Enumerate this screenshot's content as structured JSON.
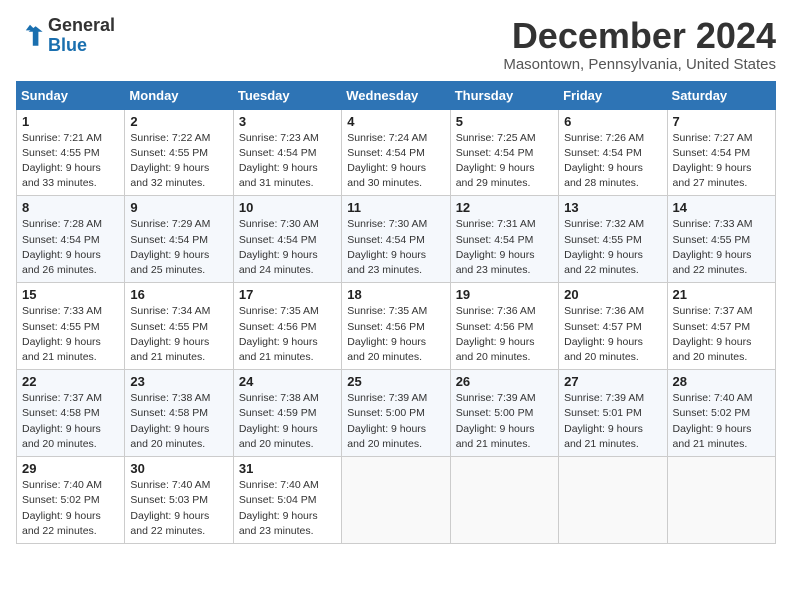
{
  "header": {
    "logo_general": "General",
    "logo_blue": "Blue",
    "main_title": "December 2024",
    "subtitle": "Masontown, Pennsylvania, United States"
  },
  "calendar": {
    "days_of_week": [
      "Sunday",
      "Monday",
      "Tuesday",
      "Wednesday",
      "Thursday",
      "Friday",
      "Saturday"
    ],
    "weeks": [
      [
        null,
        null,
        null,
        null,
        null,
        null,
        null
      ],
      null,
      null,
      null,
      null,
      null
    ],
    "cells": [
      {
        "day": "1",
        "sunrise": "7:21 AM",
        "sunset": "4:55 PM",
        "daylight": "9 hours and 33 minutes.",
        "dow": 0
      },
      {
        "day": "2",
        "sunrise": "7:22 AM",
        "sunset": "4:55 PM",
        "daylight": "9 hours and 32 minutes.",
        "dow": 1
      },
      {
        "day": "3",
        "sunrise": "7:23 AM",
        "sunset": "4:54 PM",
        "daylight": "9 hours and 31 minutes.",
        "dow": 2
      },
      {
        "day": "4",
        "sunrise": "7:24 AM",
        "sunset": "4:54 PM",
        "daylight": "9 hours and 30 minutes.",
        "dow": 3
      },
      {
        "day": "5",
        "sunrise": "7:25 AM",
        "sunset": "4:54 PM",
        "daylight": "9 hours and 29 minutes.",
        "dow": 4
      },
      {
        "day": "6",
        "sunrise": "7:26 AM",
        "sunset": "4:54 PM",
        "daylight": "9 hours and 28 minutes.",
        "dow": 5
      },
      {
        "day": "7",
        "sunrise": "7:27 AM",
        "sunset": "4:54 PM",
        "daylight": "9 hours and 27 minutes.",
        "dow": 6
      },
      {
        "day": "8",
        "sunrise": "7:28 AM",
        "sunset": "4:54 PM",
        "daylight": "9 hours and 26 minutes.",
        "dow": 0
      },
      {
        "day": "9",
        "sunrise": "7:29 AM",
        "sunset": "4:54 PM",
        "daylight": "9 hours and 25 minutes.",
        "dow": 1
      },
      {
        "day": "10",
        "sunrise": "7:30 AM",
        "sunset": "4:54 PM",
        "daylight": "9 hours and 24 minutes.",
        "dow": 2
      },
      {
        "day": "11",
        "sunrise": "7:30 AM",
        "sunset": "4:54 PM",
        "daylight": "9 hours and 23 minutes.",
        "dow": 3
      },
      {
        "day": "12",
        "sunrise": "7:31 AM",
        "sunset": "4:54 PM",
        "daylight": "9 hours and 23 minutes.",
        "dow": 4
      },
      {
        "day": "13",
        "sunrise": "7:32 AM",
        "sunset": "4:55 PM",
        "daylight": "9 hours and 22 minutes.",
        "dow": 5
      },
      {
        "day": "14",
        "sunrise": "7:33 AM",
        "sunset": "4:55 PM",
        "daylight": "9 hours and 22 minutes.",
        "dow": 6
      },
      {
        "day": "15",
        "sunrise": "7:33 AM",
        "sunset": "4:55 PM",
        "daylight": "9 hours and 21 minutes.",
        "dow": 0
      },
      {
        "day": "16",
        "sunrise": "7:34 AM",
        "sunset": "4:55 PM",
        "daylight": "9 hours and 21 minutes.",
        "dow": 1
      },
      {
        "day": "17",
        "sunrise": "7:35 AM",
        "sunset": "4:56 PM",
        "daylight": "9 hours and 21 minutes.",
        "dow": 2
      },
      {
        "day": "18",
        "sunrise": "7:35 AM",
        "sunset": "4:56 PM",
        "daylight": "9 hours and 20 minutes.",
        "dow": 3
      },
      {
        "day": "19",
        "sunrise": "7:36 AM",
        "sunset": "4:56 PM",
        "daylight": "9 hours and 20 minutes.",
        "dow": 4
      },
      {
        "day": "20",
        "sunrise": "7:36 AM",
        "sunset": "4:57 PM",
        "daylight": "9 hours and 20 minutes.",
        "dow": 5
      },
      {
        "day": "21",
        "sunrise": "7:37 AM",
        "sunset": "4:57 PM",
        "daylight": "9 hours and 20 minutes.",
        "dow": 6
      },
      {
        "day": "22",
        "sunrise": "7:37 AM",
        "sunset": "4:58 PM",
        "daylight": "9 hours and 20 minutes.",
        "dow": 0
      },
      {
        "day": "23",
        "sunrise": "7:38 AM",
        "sunset": "4:58 PM",
        "daylight": "9 hours and 20 minutes.",
        "dow": 1
      },
      {
        "day": "24",
        "sunrise": "7:38 AM",
        "sunset": "4:59 PM",
        "daylight": "9 hours and 20 minutes.",
        "dow": 2
      },
      {
        "day": "25",
        "sunrise": "7:39 AM",
        "sunset": "5:00 PM",
        "daylight": "9 hours and 20 minutes.",
        "dow": 3
      },
      {
        "day": "26",
        "sunrise": "7:39 AM",
        "sunset": "5:00 PM",
        "daylight": "9 hours and 21 minutes.",
        "dow": 4
      },
      {
        "day": "27",
        "sunrise": "7:39 AM",
        "sunset": "5:01 PM",
        "daylight": "9 hours and 21 minutes.",
        "dow": 5
      },
      {
        "day": "28",
        "sunrise": "7:40 AM",
        "sunset": "5:02 PM",
        "daylight": "9 hours and 21 minutes.",
        "dow": 6
      },
      {
        "day": "29",
        "sunrise": "7:40 AM",
        "sunset": "5:02 PM",
        "daylight": "9 hours and 22 minutes.",
        "dow": 0
      },
      {
        "day": "30",
        "sunrise": "7:40 AM",
        "sunset": "5:03 PM",
        "daylight": "9 hours and 22 minutes.",
        "dow": 1
      },
      {
        "day": "31",
        "sunrise": "7:40 AM",
        "sunset": "5:04 PM",
        "daylight": "9 hours and 23 minutes.",
        "dow": 2
      }
    ],
    "labels": {
      "sunrise": "Sunrise:",
      "sunset": "Sunset:",
      "daylight": "Daylight:"
    }
  }
}
